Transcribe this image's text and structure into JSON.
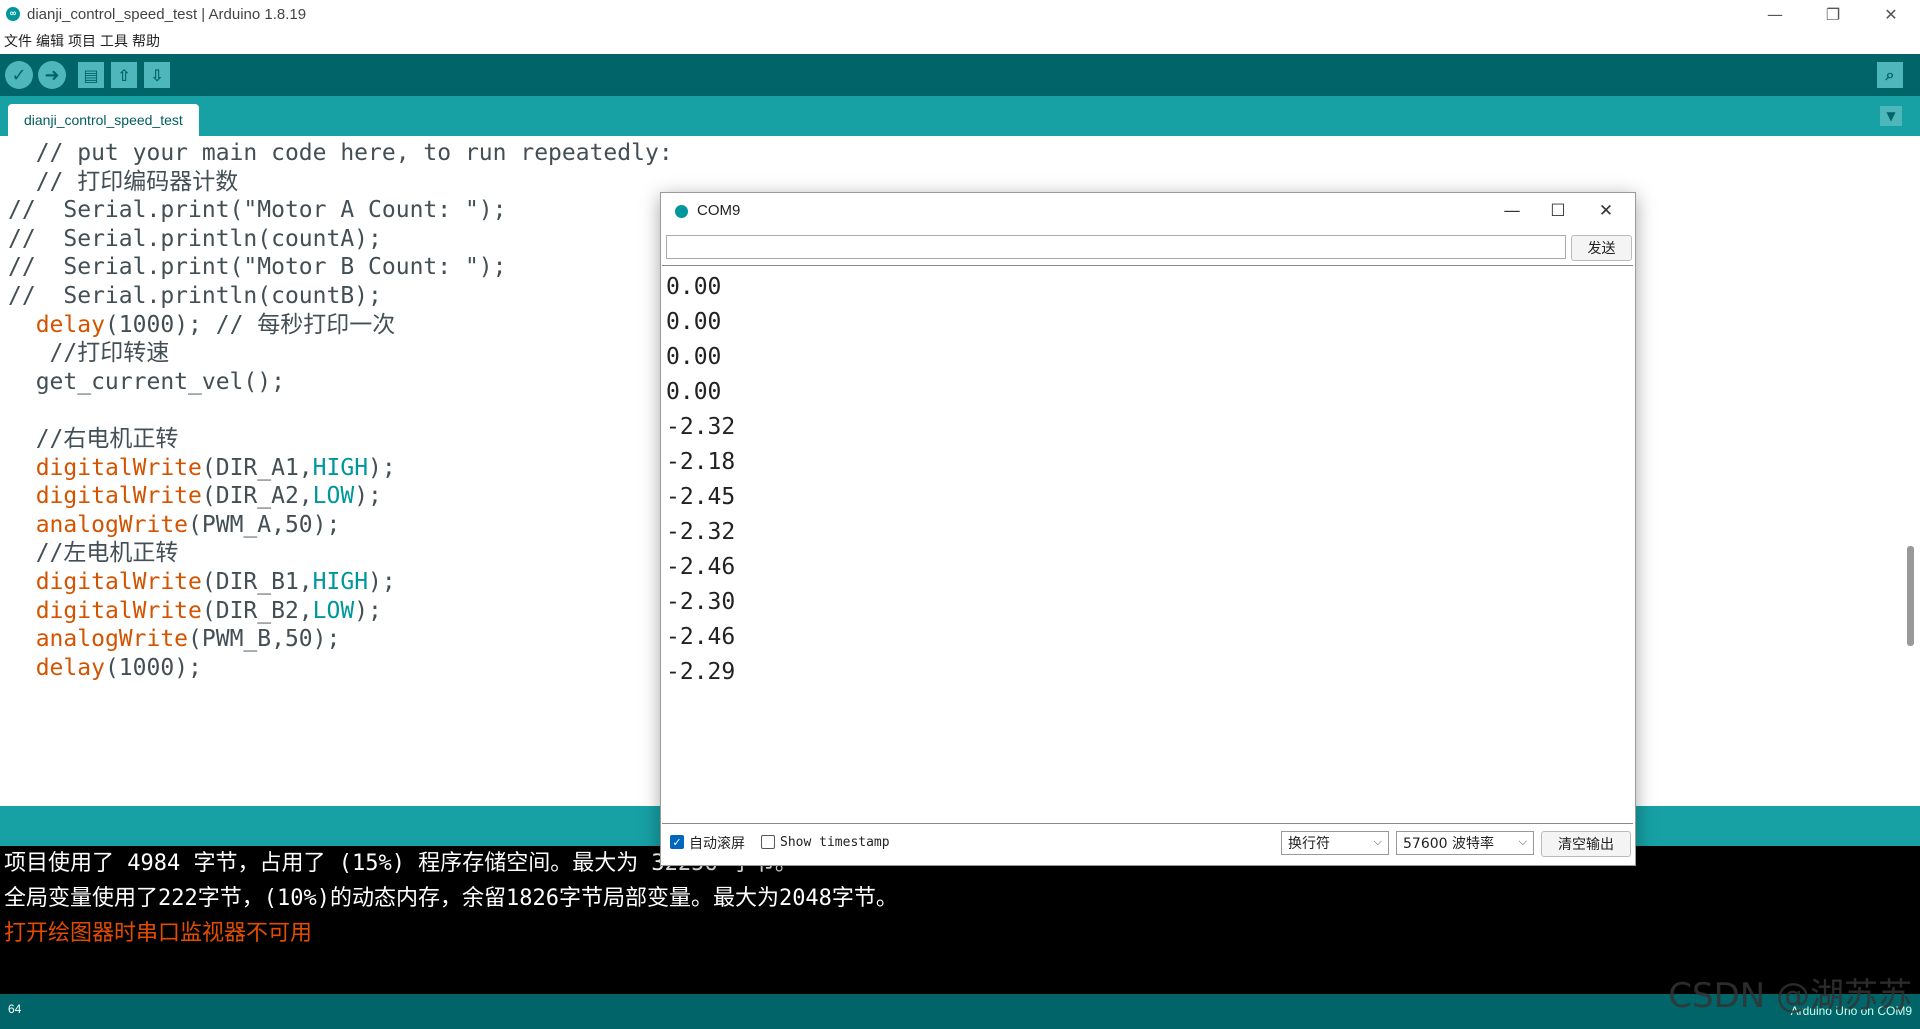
{
  "window": {
    "title": "dianji_control_speed_test | Arduino 1.8.19"
  },
  "menu": [
    "文件",
    "编辑",
    "项目",
    "工具",
    "帮助"
  ],
  "tab": {
    "label": "dianji_control_speed_test"
  },
  "code": [
    {
      "segments": [
        {
          "t": "  // put your main code here, to run repeatedly:"
        }
      ]
    },
    {
      "segments": [
        {
          "t": "  // 打印编码器计数"
        }
      ]
    },
    {
      "segments": [
        {
          "t": "//  Serial.print(\"Motor A Count: \");"
        }
      ]
    },
    {
      "segments": [
        {
          "t": "//  Serial.println(countA);"
        }
      ]
    },
    {
      "segments": [
        {
          "t": "//  Serial.print(\"Motor B Count: \");"
        }
      ]
    },
    {
      "segments": [
        {
          "t": "//  Serial.println(countB);"
        }
      ]
    },
    {
      "segments": [
        {
          "t": "  "
        },
        {
          "t": "delay",
          "c": "kw-orange"
        },
        {
          "t": "(1000); // 每秒打印一次"
        }
      ]
    },
    {
      "segments": [
        {
          "t": "   //打印转速"
        }
      ]
    },
    {
      "segments": [
        {
          "t": "  get_current_vel();"
        }
      ]
    },
    {
      "segments": [
        {
          "t": ""
        }
      ]
    },
    {
      "segments": [
        {
          "t": "  //右电机正转"
        }
      ]
    },
    {
      "segments": [
        {
          "t": "  "
        },
        {
          "t": "digitalWrite",
          "c": "kw-orange"
        },
        {
          "t": "(DIR_A1,"
        },
        {
          "t": "HIGH",
          "c": "kw-teal"
        },
        {
          "t": ");"
        }
      ]
    },
    {
      "segments": [
        {
          "t": "  "
        },
        {
          "t": "digitalWrite",
          "c": "kw-orange"
        },
        {
          "t": "(DIR_A2,"
        },
        {
          "t": "LOW",
          "c": "kw-teal"
        },
        {
          "t": ");"
        }
      ]
    },
    {
      "segments": [
        {
          "t": "  "
        },
        {
          "t": "analogWrite",
          "c": "kw-orange"
        },
        {
          "t": "(PWM_A,50);"
        }
      ]
    },
    {
      "segments": [
        {
          "t": "  //左电机正转"
        }
      ]
    },
    {
      "segments": [
        {
          "t": "  "
        },
        {
          "t": "digitalWrite",
          "c": "kw-orange"
        },
        {
          "t": "(DIR_B1,"
        },
        {
          "t": "HIGH",
          "c": "kw-teal"
        },
        {
          "t": ");"
        }
      ]
    },
    {
      "segments": [
        {
          "t": "  "
        },
        {
          "t": "digitalWrite",
          "c": "kw-orange"
        },
        {
          "t": "(DIR_B2,"
        },
        {
          "t": "LOW",
          "c": "kw-teal"
        },
        {
          "t": ");"
        }
      ]
    },
    {
      "segments": [
        {
          "t": "  "
        },
        {
          "t": "analogWrite",
          "c": "kw-orange"
        },
        {
          "t": "(PWM_B,50);"
        }
      ]
    },
    {
      "segments": [
        {
          "t": "  "
        },
        {
          "t": "delay",
          "c": "kw-orange"
        },
        {
          "t": "(1000);"
        }
      ]
    }
  ],
  "console": [
    {
      "text": "项目使用了 4984 字节，占用了 (15%) 程序存储空间。最大为 32256 字节。",
      "error": false
    },
    {
      "text": "全局变量使用了222字节，(10%)的动态内存，余留1826字节局部变量。最大为2048字节。",
      "error": false
    },
    {
      "text": "打开绘图器时串口监视器不可用",
      "error": true
    }
  ],
  "status": {
    "line": "64",
    "board": "Arduino Uno on COM9"
  },
  "watermark": "CSDN @湖苏苏",
  "serial_monitor": {
    "title": "COM9",
    "input_value": "",
    "send_label": "发送",
    "output": [
      "0.00",
      "0.00",
      "0.00",
      "0.00",
      "-2.32",
      "-2.18",
      "-2.45",
      "-2.32",
      "-2.46",
      "-2.30",
      "-2.46",
      "-2.29"
    ],
    "autoscroll_label": "自动滚屏",
    "autoscroll_checked": true,
    "timestamp_label": "Show timestamp",
    "timestamp_checked": false,
    "line_ending": "换行符",
    "baud": "57600 波特率",
    "clear_label": "清空输出"
  },
  "colors": {
    "toolbar": "#006468",
    "tabbar": "#17a1a5",
    "keyword": "#d35400",
    "constant": "#00979c",
    "console_error": "#e34c00"
  }
}
